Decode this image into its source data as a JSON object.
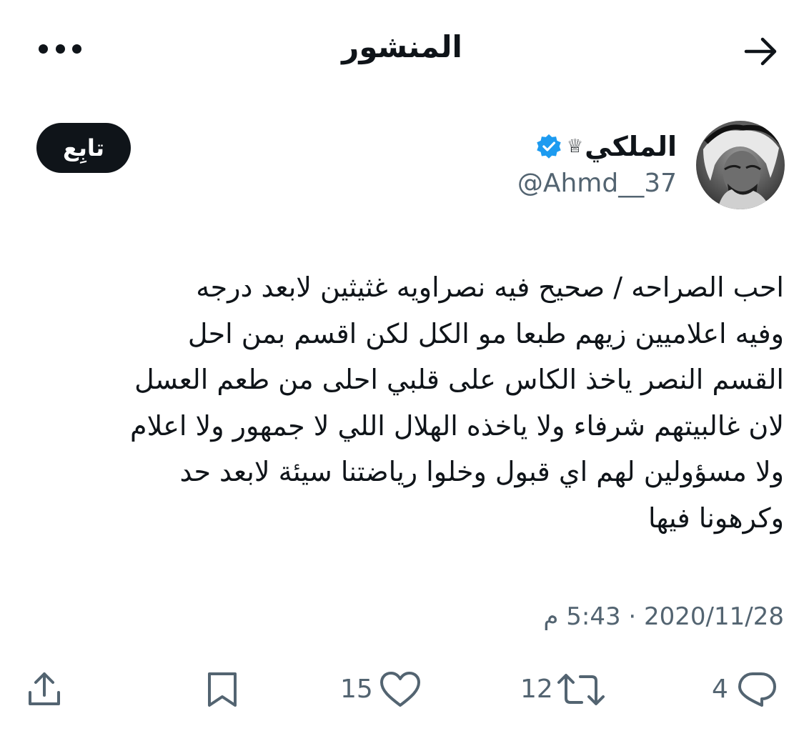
{
  "header": {
    "title": "المنشور",
    "back_icon": "arrow-right-icon",
    "more_icon": "more-horizontal-icon"
  },
  "post": {
    "author": {
      "display_name": "الملكي",
      "name_emoji": "♕",
      "handle": "@Ahmd__37",
      "verified": true,
      "verified_color": "#1d9bf0"
    },
    "follow_label": "تابِع",
    "text_lines": [
      "احب الصراحه / صحيح فيه نصراويه غثيثين لابعد درجه",
      "وفيه اعلاميين زيهم طبعا مو الكل لكن اقسم بمن احل",
      "القسم النصر ياخذ الكاس على قلبي احلى من طعم العسل",
      "لان غالبيتهم شرفاء ولا ياخذه الهلال اللي لا جمهور ولا اعلام",
      "ولا مسؤولين لهم اي قبول وخلوا رياضتنا سيئة لابعد حد",
      "وكرهونا فيها"
    ],
    "date": "2020/11/28",
    "separator": "·",
    "time": "5:43 م"
  },
  "actions": {
    "replies": "4",
    "reposts": "12",
    "likes": "15",
    "text_color": "#536471"
  }
}
